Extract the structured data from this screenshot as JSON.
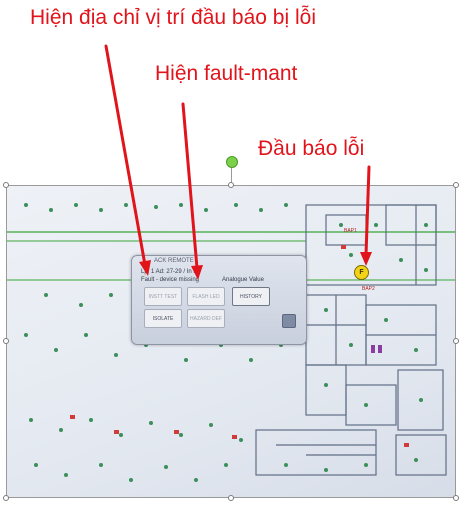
{
  "annotations": {
    "address": "Hiện địa chỉ vị trí đầu báo bị lỗi",
    "fault_mant": "Hiện fault-mant",
    "detector": "Đầu báo lỗi"
  },
  "panel": {
    "title": "ACK REMOTE",
    "address": "Lp: 1  Ad: 27-29 / In F",
    "fault": "Fault - device missing",
    "analogue": "Analogue Value",
    "buttons": {
      "test": "INSTT TEST",
      "flash": "FLASH LED",
      "history": "HISTORY",
      "isolate": "ISOLATE",
      "hazard": "HAZARD DEF"
    }
  },
  "floorplan": {
    "marker_label": "F",
    "room_labels": [
      "BAP1",
      "BAP2"
    ]
  },
  "colors": {
    "annotation": "#e2141b",
    "fault_marker": "#f3d318",
    "plan_line": "#5f6e86",
    "green_line": "#3aa53a"
  }
}
